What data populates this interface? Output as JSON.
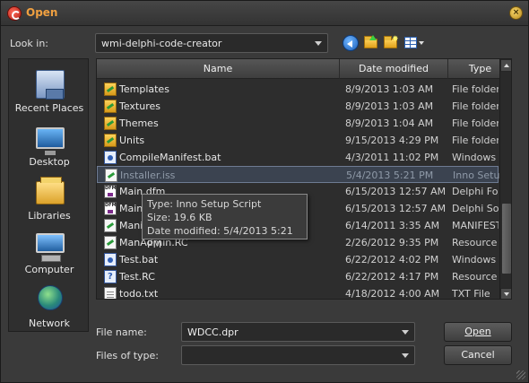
{
  "window": {
    "title": "Open"
  },
  "look_in": {
    "label": "Look in:",
    "value": "wmi-delphi-code-creator"
  },
  "toolbar": {
    "back_icon": "back-arrow",
    "up_icon": "up-folder",
    "new_folder_icon": "new-folder",
    "view_menu_icon": "view-menu"
  },
  "places": [
    {
      "label": "Recent Places",
      "icon": "recent-places"
    },
    {
      "label": "Desktop",
      "icon": "desktop"
    },
    {
      "label": "Libraries",
      "icon": "libraries"
    },
    {
      "label": "Computer",
      "icon": "computer"
    },
    {
      "label": "Network",
      "icon": "network"
    }
  ],
  "file_list": {
    "columns": [
      "Name",
      "Date modified",
      "Type"
    ],
    "rows": [
      {
        "name": "Templates",
        "date": "8/9/2013 1:03 AM",
        "type": "File folder",
        "icon": "folder"
      },
      {
        "name": "Textures",
        "date": "8/9/2013 1:03 AM",
        "type": "File folder",
        "icon": "folder"
      },
      {
        "name": "Themes",
        "date": "8/9/2013 1:04 AM",
        "type": "File folder",
        "icon": "folder"
      },
      {
        "name": "Units",
        "date": "9/15/2013 4:29 PM",
        "type": "File folder",
        "icon": "folder"
      },
      {
        "name": "CompileManifest.bat",
        "date": "4/3/2011 11:02 PM",
        "type": "Windows",
        "icon": "batch"
      },
      {
        "name": "Installer.iss",
        "date": "5/4/2013 5:21 PM",
        "type": "Inno Setup",
        "icon": "green"
      },
      {
        "name": "Main.dfm",
        "date": "6/15/2013 12:57 AM",
        "type": "Delphi Fo",
        "icon": "delphi"
      },
      {
        "name": "Main",
        "date": "6/15/2013 12:57 AM",
        "type": "Delphi So",
        "icon": "delphi"
      },
      {
        "name": "Mani",
        "date": "6/14/2011 3:35 AM",
        "type": "MANIFEST",
        "icon": "green"
      },
      {
        "name": "ManAdmin.RC",
        "date": "2/26/2012 9:35 PM",
        "type": "Resource",
        "icon": "green"
      },
      {
        "name": "Test.bat",
        "date": "6/22/2012 4:02 PM",
        "type": "Windows",
        "icon": "batch"
      },
      {
        "name": "Test.RC",
        "date": "6/22/2012 4:17 PM",
        "type": "Resource",
        "icon": "rc"
      },
      {
        "name": "todo.txt",
        "date": "4/18/2012 4:00 AM",
        "type": "TXT File",
        "icon": "txt"
      }
    ],
    "selected_index": 5
  },
  "tooltip": {
    "type": "Type: Inno Setup Script",
    "size": "Size: 19.6 KB",
    "date": "Date modified: 5/4/2013 5:21 PM"
  },
  "file_name": {
    "label": "File name:",
    "value": "WDCC.dpr"
  },
  "files_of_type": {
    "label": "Files of type:",
    "value": ""
  },
  "buttons": {
    "open": "Open",
    "cancel": "Cancel"
  },
  "colors": {
    "title": "#f0a040",
    "background": "#3a3a3a"
  }
}
